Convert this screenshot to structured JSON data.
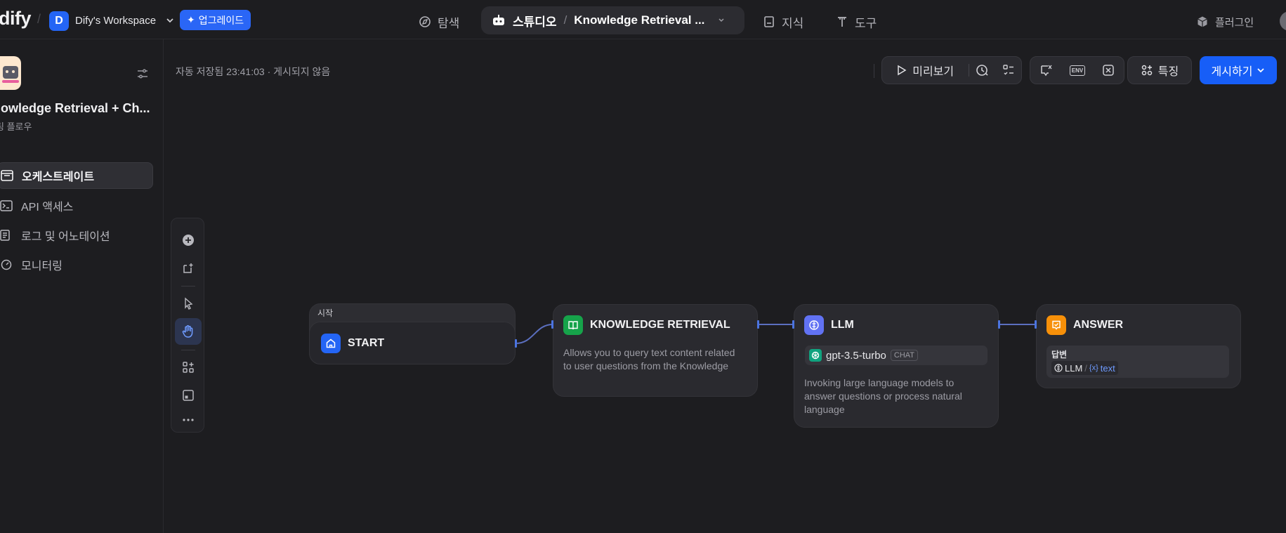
{
  "topbar": {
    "logo": "dify",
    "workspace_initial": "D",
    "workspace_name": "Dify's Workspace",
    "upgrade_label": "업그레이드",
    "nav": {
      "explore": "탐색",
      "studio": "스튜디오",
      "app_name": "Knowledge Retrieval ...",
      "knowledge": "지식",
      "tools": "도구"
    },
    "plugins": "플러그인"
  },
  "sidebar": {
    "app_title": "nowledge Retrieval + Ch...",
    "app_type": "팅 플로우",
    "items": [
      {
        "label": "오케스트레이트",
        "icon": "orchestrate-icon",
        "active": true
      },
      {
        "label": "API 액세스",
        "icon": "terminal-icon",
        "active": false
      },
      {
        "label": "로그 및 어노테이션",
        "icon": "logs-icon",
        "active": false
      },
      {
        "label": "모니터링",
        "icon": "monitor-icon",
        "active": false
      }
    ]
  },
  "canvas": {
    "autosave": "자동 저장됨 23:41:03 · 게시되지 않음",
    "preview_label": "미리보기",
    "features_label": "특징",
    "publish_label": "게시하기",
    "env_label": "ENV"
  },
  "nodes": {
    "start": {
      "group_label": "시작",
      "title": "START",
      "color": "#2465f5"
    },
    "knowledge": {
      "title": "KNOWLEDGE RETRIEVAL",
      "desc": "Allows you to query text content related to user questions from the Knowledge",
      "color": "#16a34a"
    },
    "llm": {
      "title": "LLM",
      "model": "gpt-3.5-turbo",
      "model_tag": "CHAT",
      "desc": "Invoking large language models to answer questions or process natural language",
      "color": "#6172f3"
    },
    "answer": {
      "title": "ANSWER",
      "field_label": "답변",
      "ref_node": "LLM",
      "ref_var": "text",
      "color": "#f79009"
    }
  }
}
